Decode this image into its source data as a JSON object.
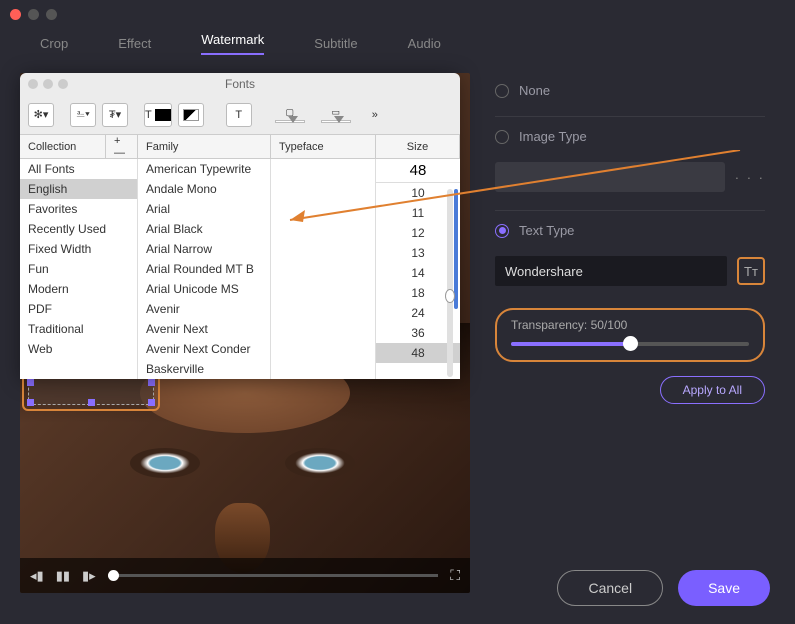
{
  "tabs": [
    "Crop",
    "Effect",
    "Watermark",
    "Subtitle",
    "Audio"
  ],
  "active_tab": "Watermark",
  "fonts_panel": {
    "title": "Fonts",
    "columns": {
      "collection": "Collection",
      "family": "Family",
      "typeface": "Typeface",
      "size": "Size"
    },
    "collections": [
      "All Fonts",
      "English",
      "Favorites",
      "Recently Used",
      "Fixed Width",
      "Fun",
      "Modern",
      "PDF",
      "Traditional",
      "Web"
    ],
    "selected_collection": "English",
    "families": [
      "American Typewrite",
      "Andale Mono",
      "Arial",
      "Arial Black",
      "Arial Narrow",
      "Arial Rounded MT B",
      "Arial Unicode MS",
      "Avenir",
      "Avenir Next",
      "Avenir Next Conder",
      "Baskerville"
    ],
    "size_value": "48",
    "sizes": [
      "10",
      "11",
      "12",
      "13",
      "14",
      "18",
      "24",
      "36",
      "48"
    ],
    "selected_size": "48",
    "plus_minus": "+   —",
    "toolbar_t": "T",
    "chevrons": "»"
  },
  "options": {
    "none": "None",
    "image": "Image Type",
    "text": "Text Type",
    "text_value": "Wondershare",
    "tt_icon": "Tᴛ",
    "dots": "· · ·"
  },
  "transparency": {
    "label": "Transparency: 50/100",
    "value": 50
  },
  "apply": "Apply to All",
  "cancel": "Cancel",
  "save": "Save",
  "play": {
    "prev": "◂▮",
    "pause": "▮▮",
    "next": "▮▸",
    "fs": "⛶"
  }
}
